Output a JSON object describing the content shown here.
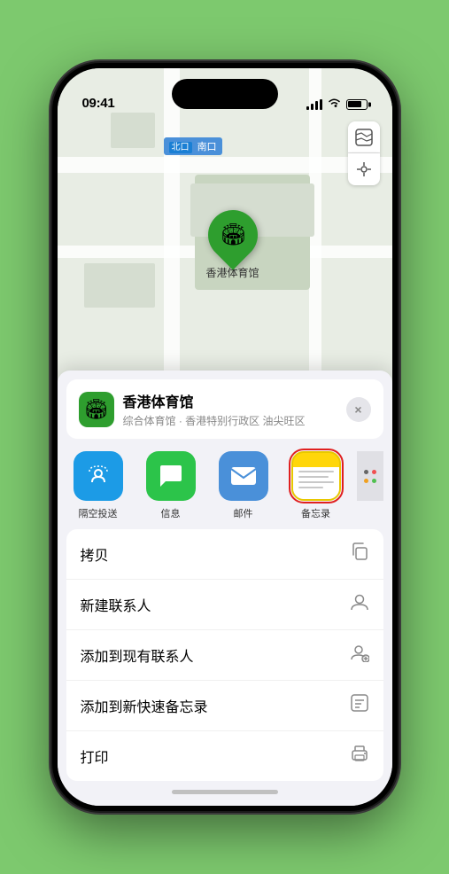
{
  "status_bar": {
    "time": "09:41",
    "location_icon": "▶"
  },
  "map": {
    "north_label": "南口",
    "stadium_label": "香港体育馆",
    "map_icon": "🗺",
    "location_arrow": "➤"
  },
  "location_card": {
    "name": "香港体育馆",
    "subtitle": "综合体育馆 · 香港特别行政区 油尖旺区",
    "close_label": "×"
  },
  "share_items": [
    {
      "id": "airdrop",
      "label": "隔空投送",
      "type": "airdrop"
    },
    {
      "id": "messages",
      "label": "信息",
      "type": "messages"
    },
    {
      "id": "mail",
      "label": "邮件",
      "type": "mail"
    },
    {
      "id": "notes",
      "label": "备忘录",
      "type": "notes"
    }
  ],
  "actions": [
    {
      "label": "拷贝",
      "icon": "copy"
    },
    {
      "label": "新建联系人",
      "icon": "person"
    },
    {
      "label": "添加到现有联系人",
      "icon": "person-add"
    },
    {
      "label": "添加到新快速备忘录",
      "icon": "note"
    },
    {
      "label": "打印",
      "icon": "print"
    }
  ]
}
